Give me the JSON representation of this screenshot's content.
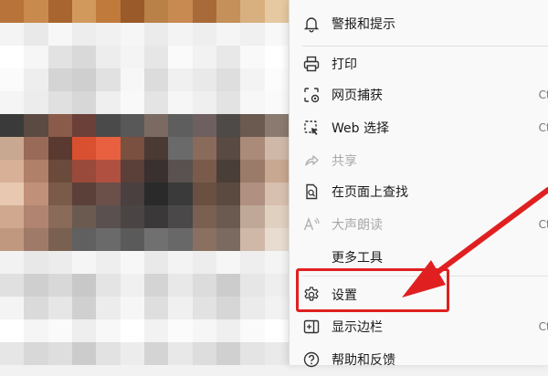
{
  "menu": {
    "items": [
      {
        "label": "警报和提示",
        "icon": "bell-icon",
        "enabled": true
      },
      {
        "label": "打印",
        "icon": "printer-icon",
        "enabled": true
      },
      {
        "label": "网页捕获",
        "icon": "web-capture-icon",
        "enabled": true,
        "shortcut": "Ctrl"
      },
      {
        "label": "Web 选择",
        "icon": "web-select-icon",
        "enabled": true,
        "shortcut": "Ctrl"
      },
      {
        "label": "共享",
        "icon": "share-icon",
        "enabled": false
      },
      {
        "label": "在页面上查找",
        "icon": "find-icon",
        "enabled": true
      },
      {
        "label": "大声朗读",
        "icon": "read-aloud-icon",
        "enabled": false,
        "shortcut": "Ctrl"
      },
      {
        "label": "更多工具",
        "icon": "",
        "enabled": true
      },
      {
        "label": "设置",
        "icon": "gear-icon",
        "enabled": true
      },
      {
        "label": "显示边栏",
        "icon": "sidebar-icon",
        "enabled": true,
        "shortcut": "Ctrl"
      },
      {
        "label": "帮助和反馈",
        "icon": "help-icon",
        "enabled": true
      }
    ]
  },
  "annotation": {
    "color": "#e02020",
    "target": "设置"
  },
  "colors": {
    "menu_bg": "#f9f9f9",
    "text": "#1a1a1a",
    "disabled_text": "#a8a8a8",
    "accent": "#e02020"
  }
}
